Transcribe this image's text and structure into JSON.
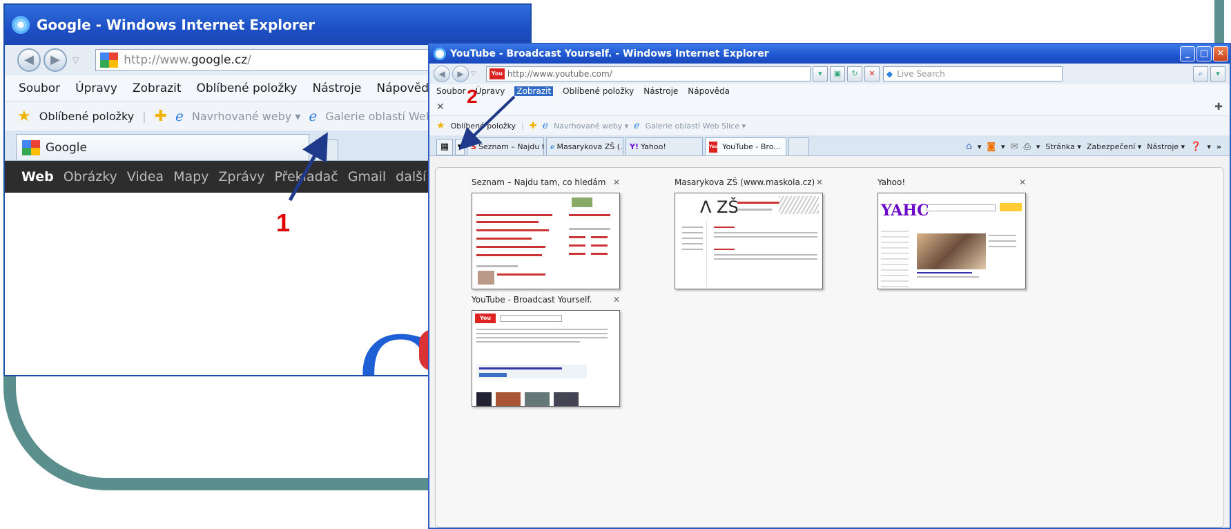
{
  "window1": {
    "title": "Google - Windows Internet Explorer",
    "address_prefix": "http://www.",
    "address_domain": "google.cz",
    "address_suffix": "/",
    "menu": [
      "Soubor",
      "Úpravy",
      "Zobrazit",
      "Oblíbené položky",
      "Nástroje",
      "Nápověda"
    ],
    "favorites_label": "Oblíbené položky",
    "suggested_sites": "Navrhované weby ▾",
    "web_slice_gallery": "Galerie oblastí Web Slice ▾",
    "tab_label": "Google",
    "google_bar": [
      "Web",
      "Obrázky",
      "Videa",
      "Mapy",
      "Zprávy",
      "Překladač",
      "Gmail",
      "další ▾"
    ]
  },
  "window2": {
    "title": "YouTube - Broadcast Yourself. - Windows Internet Explorer",
    "address": "http://www.youtube.com/",
    "search_placeholder": "Live Search",
    "menu": [
      "Soubor",
      "Úpravy",
      "Zobrazit",
      "Oblíbené položky",
      "Nástroje",
      "Nápověda"
    ],
    "selected_menu": "Zobrazit",
    "favorites_label": "Oblíbené položky",
    "suggested_sites": "Navrhované weby ▾",
    "web_slice_gallery": "Galerie oblastí Web Slice ▾",
    "tabs": [
      {
        "label": "Seznam – Najdu t..."
      },
      {
        "label": "Masarykova ZŠ (..."
      },
      {
        "label": "Yahoo!"
      },
      {
        "label": "YouTube - Bro..."
      }
    ],
    "tools": [
      "Stránka ▾",
      "Zabezpečení ▾",
      "Nástroje ▾"
    ],
    "quick_tabs": [
      {
        "title": "Seznam – Najdu tam, co hledám"
      },
      {
        "title": "Masarykova ZŠ (www.maskola.cz)"
      },
      {
        "title": "Yahoo!"
      },
      {
        "title": "YouTube - Broadcast Yourself."
      }
    ]
  },
  "annotations": {
    "one": "1",
    "two": "2"
  },
  "colors": {
    "accent_red": "#e00000",
    "arrow": "#1f3a8a",
    "teal": "#5b8f8d"
  }
}
